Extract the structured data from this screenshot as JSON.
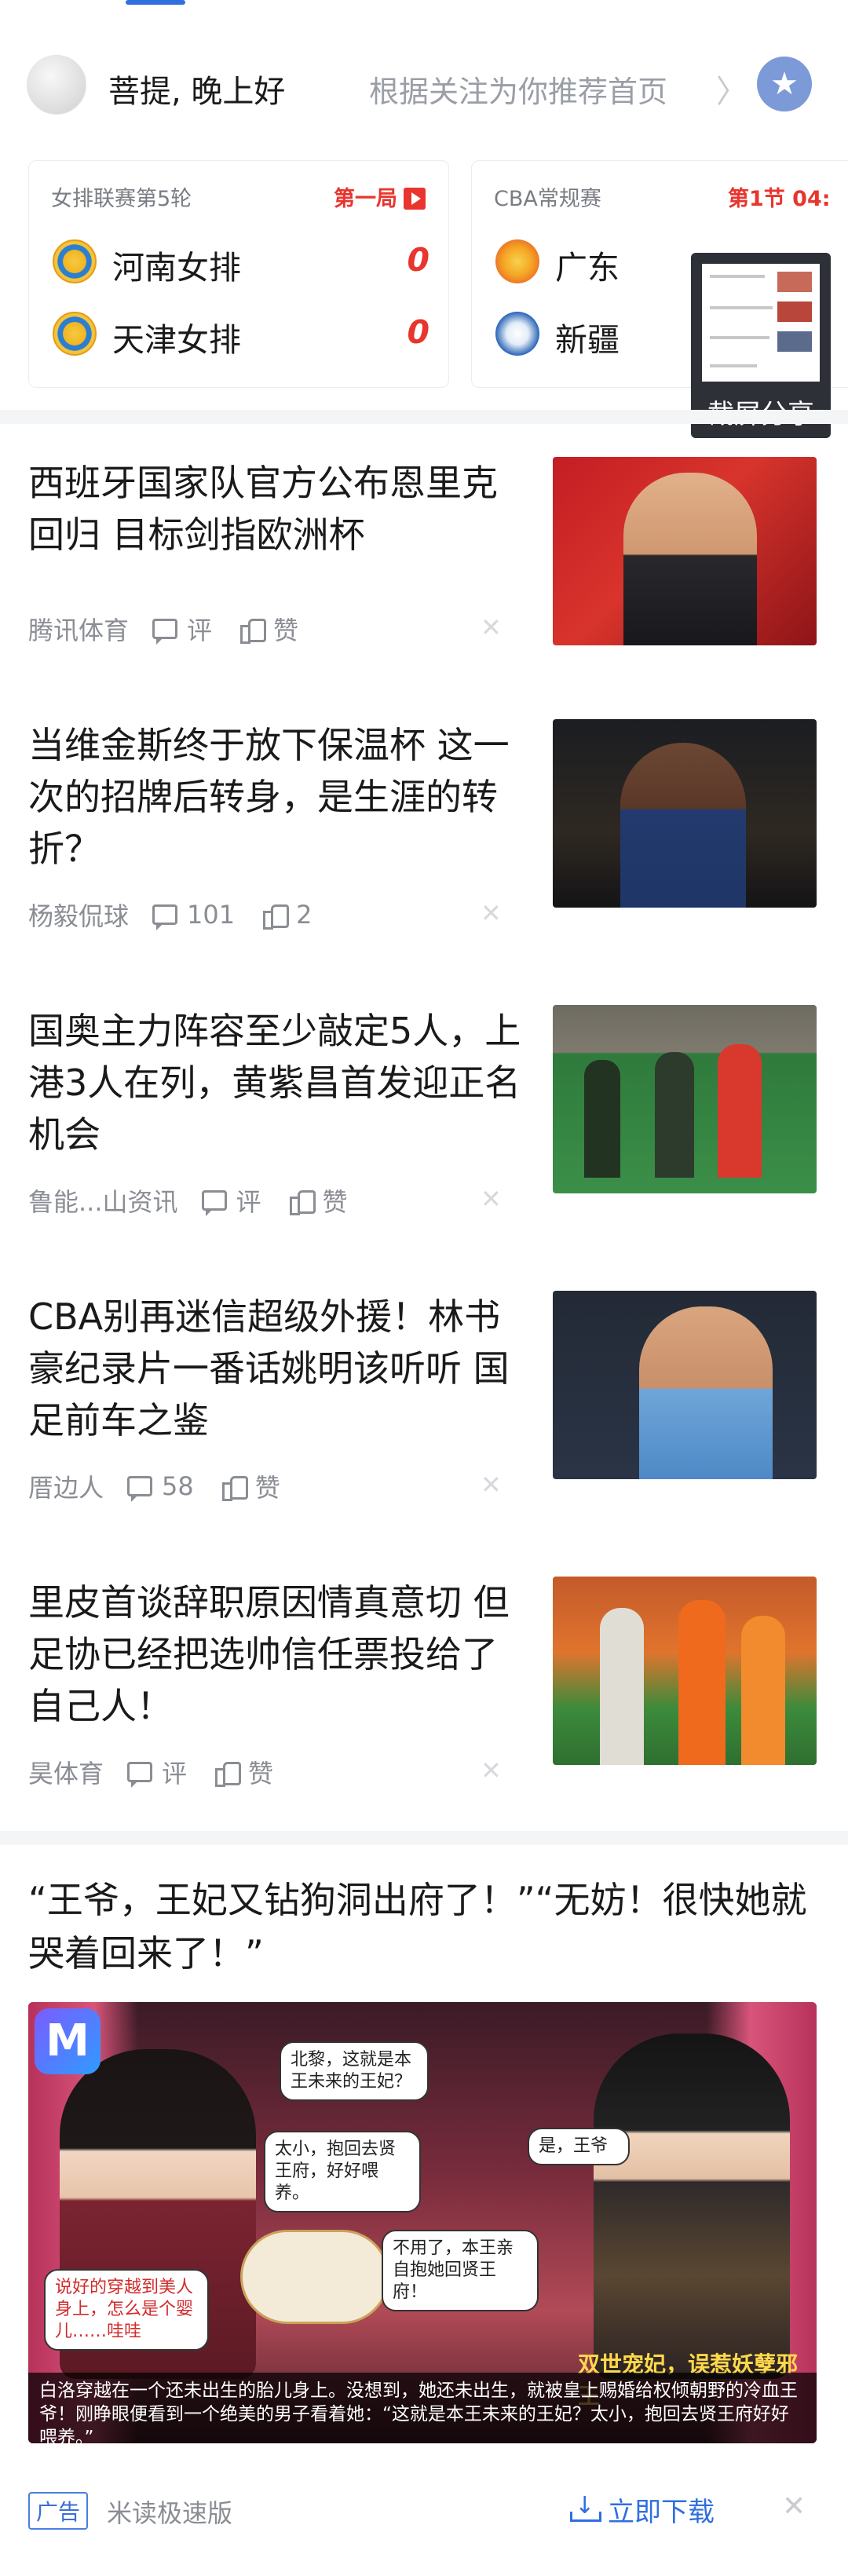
{
  "header": {
    "greeting": "菩提, 晚上好",
    "recommend_text": "根据关注为你推荐首页",
    "recommend_arrow": "〉"
  },
  "score_cards": [
    {
      "league": "女排联赛第5轮",
      "status": "第一局",
      "teams": [
        {
          "name": "河南女排",
          "score": "0"
        },
        {
          "name": "天津女排",
          "score": "0"
        }
      ]
    },
    {
      "league": "CBA常规赛",
      "status": "第1节 04:",
      "teams": [
        {
          "name": "广东",
          "score": ""
        },
        {
          "name": "新疆",
          "score": ""
        }
      ]
    }
  ],
  "share_overlay": {
    "label": "截屏分享"
  },
  "news": [
    {
      "title": "西班牙国家队官方公布恩里克回归 目标剑指欧洲杯",
      "source": "腾讯体育",
      "comments": "评",
      "likes": "赞"
    },
    {
      "title": "当维金斯终于放下保温杯 这一次的招牌后转身，是生涯的转折？",
      "source": "杨毅侃球",
      "comments": "101",
      "likes": "2"
    },
    {
      "title": "国奥主力阵容至少敲定5人，上港3人在列，黄紫昌首发迎正名机会",
      "source": "鲁能...山资讯",
      "comments": "评",
      "likes": "赞"
    },
    {
      "title": "CBA别再迷信超级外援！林书豪纪录片一番话姚明该听听 国足前车之鉴",
      "source": "厝边人",
      "comments": "58",
      "likes": "赞"
    },
    {
      "title": "里皮首谈辞职原因情真意切 但足协已经把选帅信任票投给了自己人！",
      "source": "昊体育",
      "comments": "评",
      "likes": "赞"
    }
  ],
  "ad": {
    "title": "“王爷，王妃又钻狗洞出府了！”“无妨！很快她就哭着回来了！”",
    "bubbles": [
      "北黎，这就是本王未来的王妃？",
      "太小，抱回去贤王府，好好喂养。",
      "是，王爷",
      "不用了，本王亲自抱她回贤王府！",
      "说好的穿越到美人身上，怎么是个婴儿……哇哇"
    ],
    "tag": "双世宠妃，误惹妖孽邪王",
    "caption": "白洛穿越在一个还未出生的胎儿身上。没想到，她还未出生，就被皇上赐婚给权倾朝野的冷血王爷！刚睁眼便看到一个绝美的男子看着她：“这就是本王未来的王妃？太小，抱回去贤王府好好喂养。”",
    "badge": "广告",
    "source": "米读极速版",
    "download": "立即下载"
  }
}
